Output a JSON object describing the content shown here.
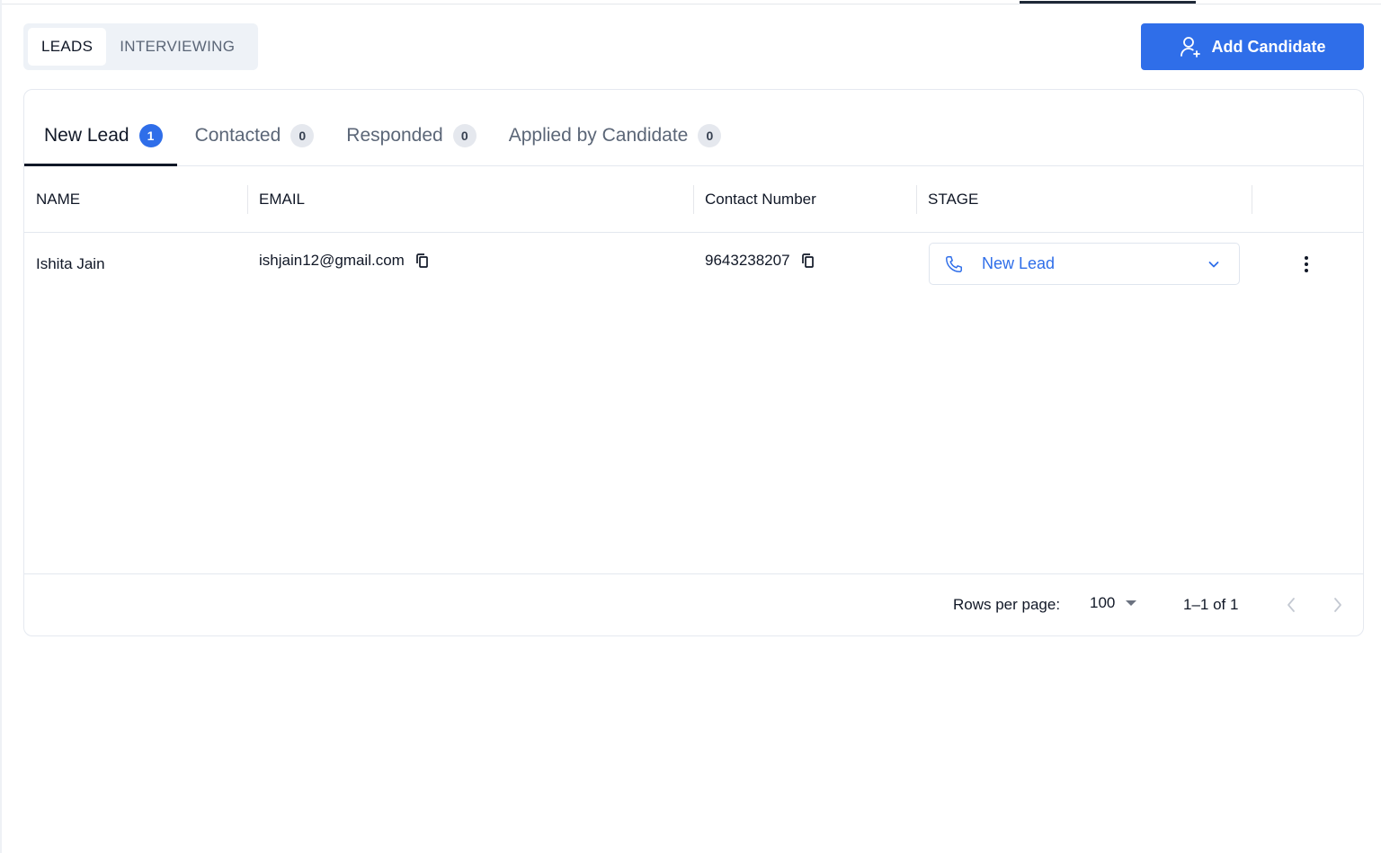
{
  "view_toggle": {
    "options": [
      {
        "label": "LEADS",
        "active": true
      },
      {
        "label": "INTERVIEWING",
        "active": false
      }
    ]
  },
  "add_button": {
    "label": "Add Candidate",
    "icon": "user-plus-icon"
  },
  "colors": {
    "accent": "#2f6ee9",
    "text_primary": "#111827",
    "text_muted": "#5b6677",
    "border": "#e3e8ef"
  },
  "stage_tabs": [
    {
      "label": "New Lead",
      "count": "1",
      "active": true
    },
    {
      "label": "Contacted",
      "count": "0",
      "active": false
    },
    {
      "label": "Responded",
      "count": "0",
      "active": false
    },
    {
      "label": "Applied by Candidate",
      "count": "0",
      "active": false
    }
  ],
  "table": {
    "columns": [
      "NAME",
      "EMAIL",
      "Contact Number",
      "STAGE",
      ""
    ],
    "rows": [
      {
        "name": "Ishita Jain",
        "email": "ishjain12@gmail.com",
        "contact_number": "9643238207",
        "stage": "New Lead",
        "stage_icon": "phone-icon"
      }
    ]
  },
  "pagination": {
    "rows_per_page_label": "Rows per page:",
    "rows_per_page": "100",
    "range": "1–1 of 1"
  }
}
